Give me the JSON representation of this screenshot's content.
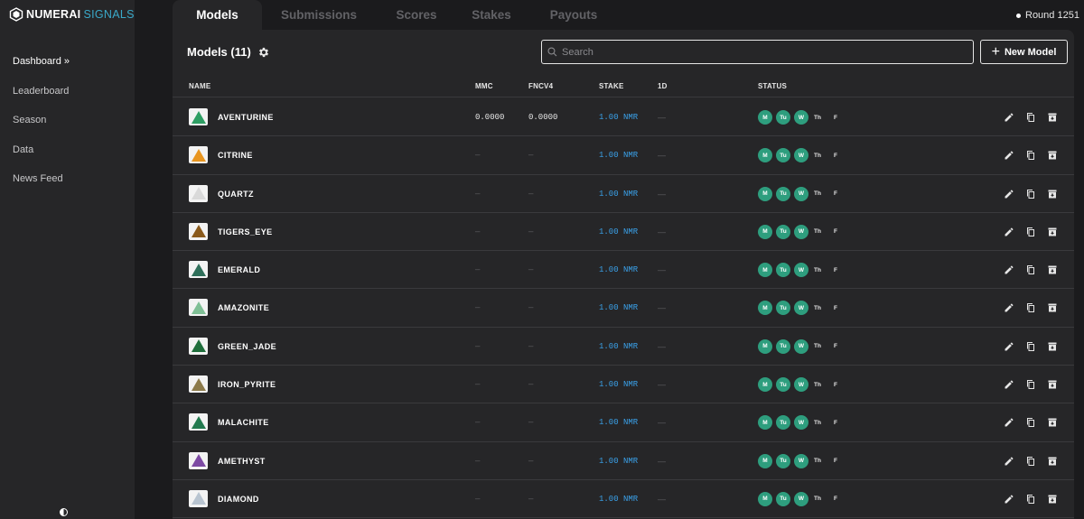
{
  "app": {
    "logo_primary": "NUMERAI",
    "logo_secondary": "SIGNALS",
    "accent_color": "#3aa9c9"
  },
  "sidebar": {
    "items": [
      {
        "label": "Dashboard »",
        "active": true
      },
      {
        "label": "Leaderboard",
        "active": false
      },
      {
        "label": "Season",
        "active": false
      },
      {
        "label": "Data",
        "active": false
      },
      {
        "label": "News Feed",
        "active": false
      }
    ]
  },
  "tabs": [
    {
      "label": "Models",
      "active": true
    },
    {
      "label": "Submissions",
      "active": false
    },
    {
      "label": "Scores",
      "active": false
    },
    {
      "label": "Stakes",
      "active": false
    },
    {
      "label": "Payouts",
      "active": false
    }
  ],
  "round": {
    "label": "Round 1251"
  },
  "panel": {
    "title": "Models (11)",
    "search_placeholder": "Search",
    "new_model_label": "New Model"
  },
  "table": {
    "columns": [
      "NAME",
      "MMC",
      "FNCV4",
      "STAKE",
      "1D",
      "STATUS"
    ],
    "days": [
      "M",
      "Tu",
      "W",
      "Th",
      "F"
    ],
    "active_day_color": "#2e9e7e",
    "rows": [
      {
        "name": "AVENTURINE",
        "mmc": "0.0000",
        "fncv4": "0.0000",
        "stake": "1.00 NMR",
        "d1": "—",
        "gem_color": "#2e9e63"
      },
      {
        "name": "CITRINE",
        "mmc": "—",
        "fncv4": "—",
        "stake": "1.00 NMR",
        "d1": "—",
        "gem_color": "#e8951f"
      },
      {
        "name": "QUARTZ",
        "mmc": "—",
        "fncv4": "—",
        "stake": "1.00 NMR",
        "d1": "—",
        "gem_color": "#d9d9d9"
      },
      {
        "name": "TIGERS_EYE",
        "mmc": "—",
        "fncv4": "—",
        "stake": "1.00 NMR",
        "d1": "—",
        "gem_color": "#8a5a1c"
      },
      {
        "name": "EMERALD",
        "mmc": "—",
        "fncv4": "—",
        "stake": "1.00 NMR",
        "d1": "—",
        "gem_color": "#2f6f5a"
      },
      {
        "name": "AMAZONITE",
        "mmc": "—",
        "fncv4": "—",
        "stake": "1.00 NMR",
        "d1": "—",
        "gem_color": "#7fbf95"
      },
      {
        "name": "GREEN_JADE",
        "mmc": "—",
        "fncv4": "—",
        "stake": "1.00 NMR",
        "d1": "—",
        "gem_color": "#1f6e3b"
      },
      {
        "name": "IRON_PYRITE",
        "mmc": "—",
        "fncv4": "—",
        "stake": "1.00 NMR",
        "d1": "—",
        "gem_color": "#8c7a4a"
      },
      {
        "name": "MALACHITE",
        "mmc": "—",
        "fncv4": "—",
        "stake": "1.00 NMR",
        "d1": "—",
        "gem_color": "#237a4f"
      },
      {
        "name": "AMETHYST",
        "mmc": "—",
        "fncv4": "—",
        "stake": "1.00 NMR",
        "d1": "—",
        "gem_color": "#7d4aa3"
      },
      {
        "name": "DIAMOND",
        "mmc": "—",
        "fncv4": "—",
        "stake": "1.00 NMR",
        "d1": "—",
        "gem_color": "#b8c4d0"
      }
    ]
  }
}
